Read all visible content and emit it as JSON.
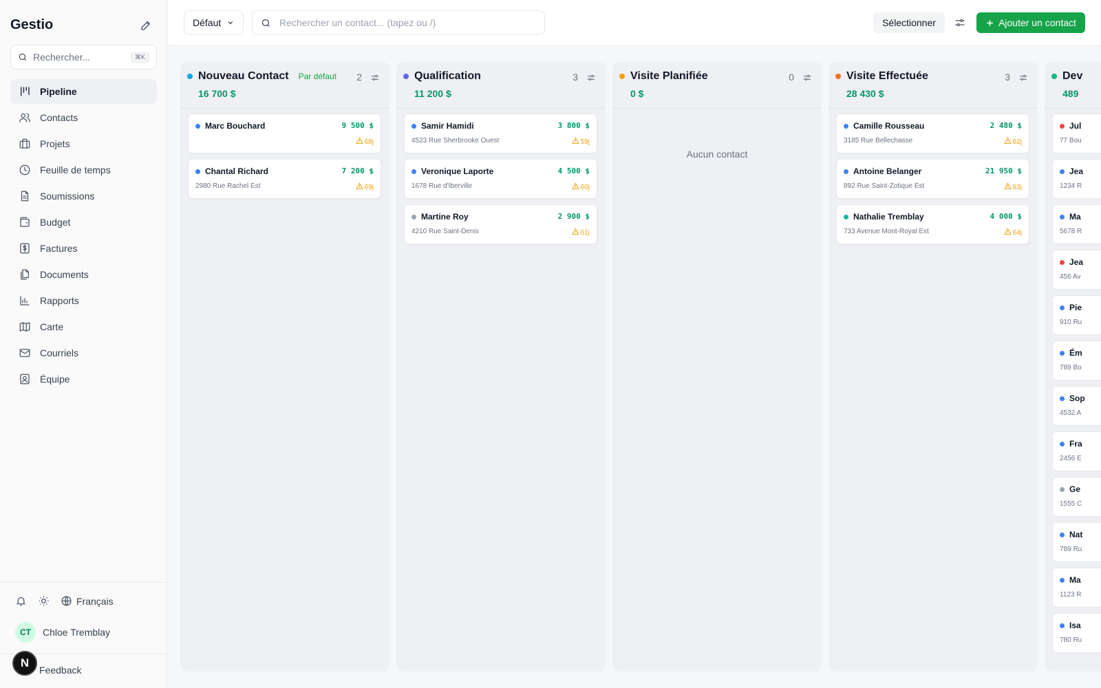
{
  "app": {
    "name": "Gestio"
  },
  "sidebar": {
    "search_placeholder": "Rechercher...",
    "search_shortcut": "⌘K",
    "items": [
      {
        "label": "Pipeline",
        "icon": "pipeline-icon",
        "active": true
      },
      {
        "label": "Contacts",
        "icon": "users-icon"
      },
      {
        "label": "Projets",
        "icon": "briefcase-icon"
      },
      {
        "label": "Feuille de temps",
        "icon": "clock-icon"
      },
      {
        "label": "Soumissions",
        "icon": "document-icon"
      },
      {
        "label": "Budget",
        "icon": "wallet-icon"
      },
      {
        "label": "Factures",
        "icon": "dollar-receipt-icon"
      },
      {
        "label": "Documents",
        "icon": "files-icon"
      },
      {
        "label": "Rapports",
        "icon": "bar-chart-icon"
      },
      {
        "label": "Carte",
        "icon": "map-icon"
      },
      {
        "label": "Courriels",
        "icon": "mail-icon"
      },
      {
        "label": "Équipe",
        "icon": "team-icon"
      }
    ],
    "language": "Français",
    "user": {
      "initials": "CT",
      "name": "Chloe Tremblay"
    },
    "feedback": "Feedback",
    "dev_badge": "N"
  },
  "topbar": {
    "view_label": "Défaut",
    "search_placeholder": "Rechercher un contact... (tapez ou /)",
    "select_label": "Sélectionner",
    "add_label": "Ajouter un contact"
  },
  "colors": {
    "accent": "#16a34a",
    "amount": "#059669",
    "warning": "#f59e0b"
  },
  "columns": [
    {
      "name": "Nouveau Contact",
      "badge": "Par défaut",
      "count": "2",
      "total": "16 700 $",
      "color": "#0ea5e9",
      "cards": [
        {
          "name": "Marc Bouchard",
          "amount": "9 500 $",
          "address": "",
          "age": "68j",
          "dot": "#3b82f6"
        },
        {
          "name": "Chantal Richard",
          "amount": "7 200 $",
          "address": "2980 Rue Rachel Est",
          "age": "69j",
          "dot": "#3b82f6"
        }
      ]
    },
    {
      "name": "Qualification",
      "count": "3",
      "total": "11 200 $",
      "color": "#6366f1",
      "cards": [
        {
          "name": "Samir Hamidi",
          "amount": "3 800 $",
          "address": "4523 Rue Sherbrooke Ouest",
          "age": "59j",
          "dot": "#3b82f6"
        },
        {
          "name": "Veronique Laporte",
          "amount": "4 500 $",
          "address": "1678 Rue d'Iberville",
          "age": "60j",
          "dot": "#3b82f6"
        },
        {
          "name": "Martine Roy",
          "amount": "2 900 $",
          "address": "4210 Rue Saint-Denis",
          "age": "61j",
          "dot": "#9ca3af"
        }
      ]
    },
    {
      "name": "Visite Planifiée",
      "count": "0",
      "total": "0 $",
      "color": "#f59e0b",
      "empty_text": "Aucun contact",
      "cards": []
    },
    {
      "name": "Visite Effectuée",
      "count": "3",
      "total": "28 430 $",
      "color": "#f97316",
      "cards": [
        {
          "name": "Camille Rousseau",
          "amount": "2 480 $",
          "address": "3185 Rue Bellechasse",
          "age": "62j",
          "dot": "#3b82f6"
        },
        {
          "name": "Antoine Belanger",
          "amount": "21 950 $",
          "address": "892 Rue Saint-Zotique Est",
          "age": "63j",
          "dot": "#3b82f6"
        },
        {
          "name": "Nathalie Tremblay",
          "amount": "4 000 $",
          "address": "733 Avenue Mont-Royal Est",
          "age": "64j",
          "dot": "#14b8a6"
        }
      ]
    },
    {
      "name": "Dev",
      "total": "489",
      "color": "#10b981",
      "cards": [
        {
          "name": "Jul",
          "address": "77 Bou",
          "dot": "#ef4444"
        },
        {
          "name": "Jea",
          "address": "1234 R",
          "dot": "#3b82f6"
        },
        {
          "name": "Ma",
          "address": "5678 R",
          "dot": "#3b82f6"
        },
        {
          "name": "Jea",
          "address": "456 Av",
          "dot": "#ef4444"
        },
        {
          "name": "Pie",
          "address": "910 Ru",
          "dot": "#3b82f6"
        },
        {
          "name": "Ém",
          "address": "789 Bo",
          "dot": "#3b82f6"
        },
        {
          "name": "Sop",
          "address": "4532 A",
          "dot": "#3b82f6"
        },
        {
          "name": "Fra",
          "address": "2456 E",
          "dot": "#3b82f6"
        },
        {
          "name": "Ge",
          "address": "1555 C",
          "dot": "#9ca3af"
        },
        {
          "name": "Nat",
          "address": "789 Ru",
          "dot": "#3b82f6"
        },
        {
          "name": "Ma",
          "address": "1123 R",
          "dot": "#3b82f6"
        },
        {
          "name": "Isa",
          "address": "780 Ru",
          "dot": "#3b82f6"
        }
      ]
    }
  ]
}
